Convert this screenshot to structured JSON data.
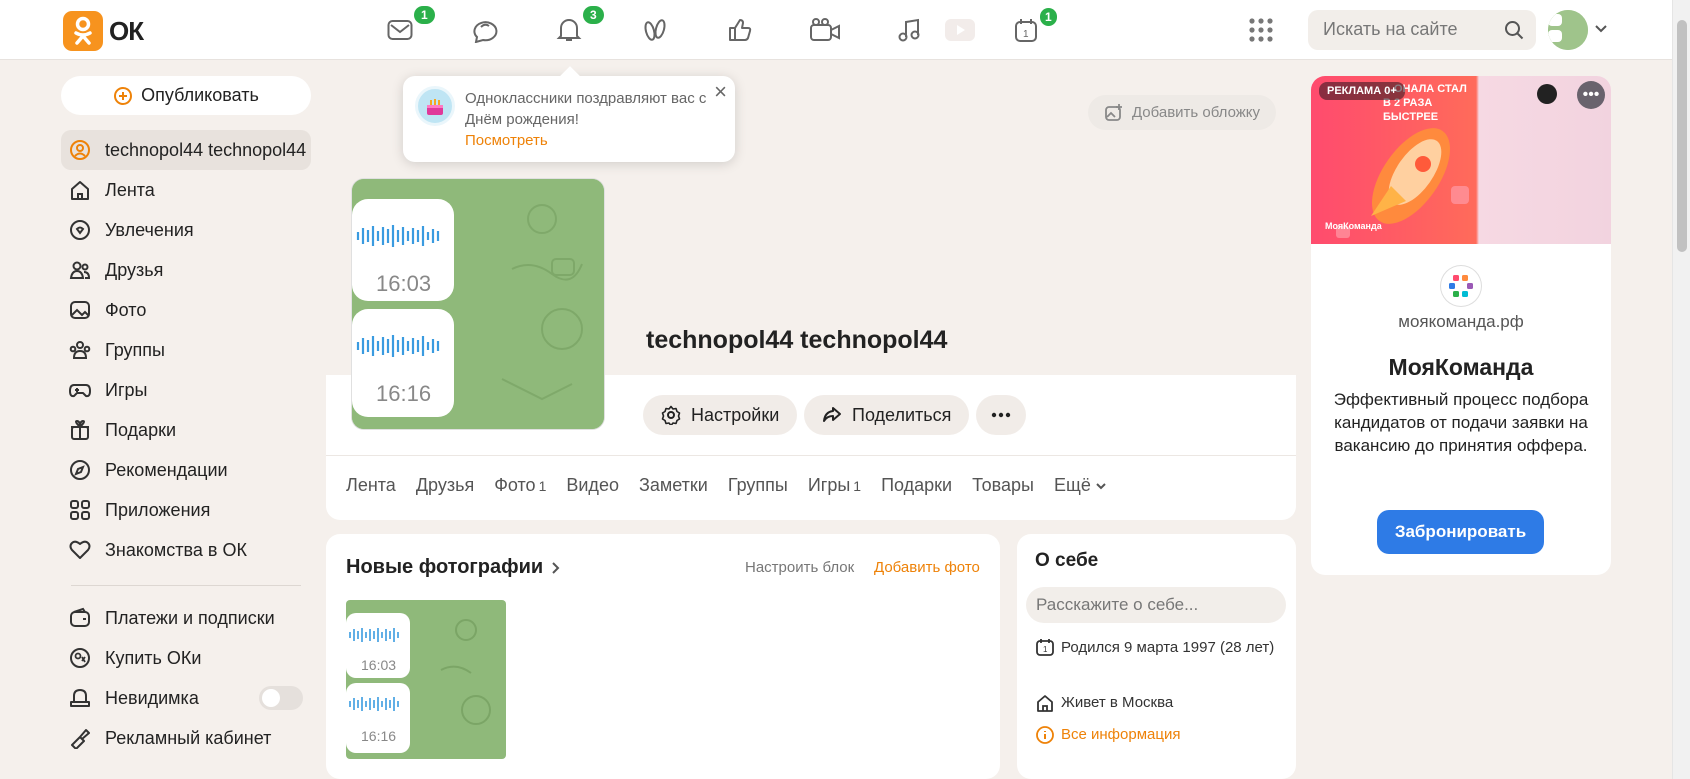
{
  "header": {
    "logo_text": "ОК",
    "badges": {
      "messages": "1",
      "notifications": "3",
      "events": "1"
    },
    "search_placeholder": "Искать на сайте"
  },
  "sidebar": {
    "publish_label": "Опубликовать",
    "items": [
      {
        "label": "technopol44 technopol44",
        "icon": "user-icon"
      },
      {
        "label": "Лента",
        "icon": "home-icon"
      },
      {
        "label": "Увлечения",
        "icon": "hobbies-icon"
      },
      {
        "label": "Друзья",
        "icon": "friends-icon"
      },
      {
        "label": "Фото",
        "icon": "photo-icon"
      },
      {
        "label": "Группы",
        "icon": "groups-icon"
      },
      {
        "label": "Игры",
        "icon": "gamepad-icon"
      },
      {
        "label": "Подарки",
        "icon": "gift-icon"
      },
      {
        "label": "Рекомендации",
        "icon": "compass-icon"
      },
      {
        "label": "Приложения",
        "icon": "apps-icon"
      },
      {
        "label": "Знакомства в ОК",
        "icon": "heart-icon"
      }
    ],
    "extra_items": [
      {
        "label": "Платежи и подписки",
        "icon": "wallet-icon"
      },
      {
        "label": "Купить ОКи",
        "icon": "coin-icon"
      },
      {
        "label": "Невидимка",
        "icon": "invisible-icon"
      },
      {
        "label": "Рекламный кабинет",
        "icon": "megaphone-icon"
      }
    ]
  },
  "notification": {
    "text": "Одноклассники поздравляют вас с Днём рождения!",
    "link": "Посмотреть"
  },
  "profile": {
    "add_cover": "Добавить обложку",
    "name": "technopol44 technopol44",
    "settings_label": "Настройки",
    "share_label": "Поделиться",
    "photo_times": [
      "16:03",
      "16:16"
    ],
    "tabs": [
      {
        "label": "Лента",
        "count": ""
      },
      {
        "label": "Друзья",
        "count": ""
      },
      {
        "label": "Фото",
        "count": "1"
      },
      {
        "label": "Видео",
        "count": ""
      },
      {
        "label": "Заметки",
        "count": ""
      },
      {
        "label": "Группы",
        "count": ""
      },
      {
        "label": "Игры",
        "count": "1"
      },
      {
        "label": "Подарки",
        "count": ""
      },
      {
        "label": "Товары",
        "count": ""
      },
      {
        "label": "Ещё",
        "count": ""
      }
    ]
  },
  "photos_block": {
    "title": "Новые фотографии",
    "configure": "Настроить блок",
    "add": "Добавить фото"
  },
  "about": {
    "title": "О себе",
    "placeholder": "Расскажите о себе...",
    "birthday": "Родился 9 марта 1997 (28 лет)",
    "lives": "Живет в Москва",
    "all_info": "Все информация"
  },
  "ad": {
    "label": "РЕКЛАМА 0+",
    "banner_text": "…ОНАЛА СТАЛ В 2 РАЗА БЫСТРЕЕ",
    "banner_brand": "МояКоманда",
    "domain": "моякоманда.рф",
    "title": "МояКоманда",
    "description": "Эффективный процесс подбора кандидатов от подачи заявки на вакансию до принятия оффера.",
    "button": "Забронировать"
  },
  "colors": {
    "accent": "#ee8208",
    "badge": "#2bb04a",
    "ad_button": "#2e7be6"
  }
}
